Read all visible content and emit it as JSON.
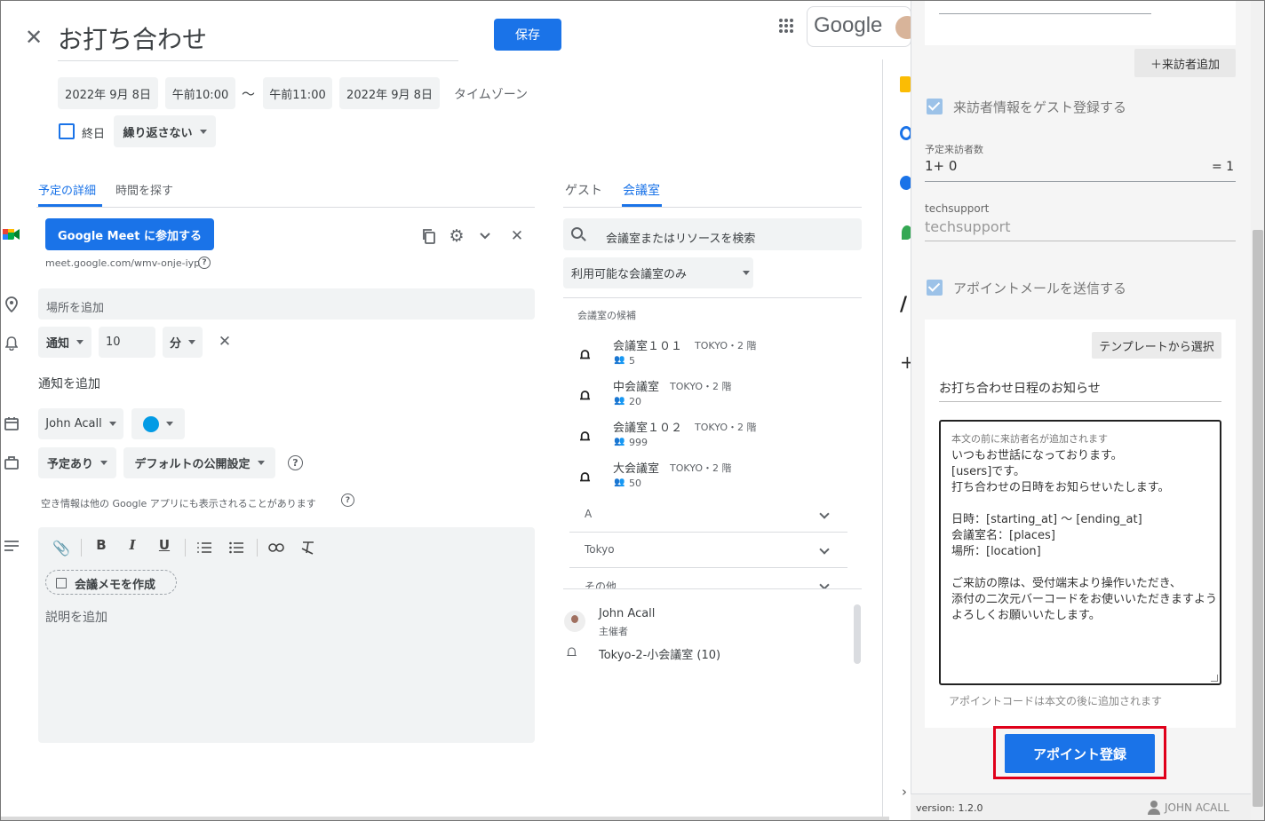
{
  "header": {
    "title": "お打ち合わせ",
    "save_label": "保存",
    "google_label": "Google"
  },
  "datetime": {
    "start_date": "2022年 9月 8日",
    "start_time": "午前10:00",
    "separator": "～",
    "end_time": "午前11:00",
    "end_date": "2022年 9月 8日",
    "timezone": "タイムゾーン"
  },
  "repeat": {
    "allday_label": "終日",
    "repeat_value": "繰り返さない"
  },
  "tabs": {
    "details": "予定の詳細",
    "find_time": "時間を探す",
    "guests": "ゲスト",
    "rooms": "会議室"
  },
  "meet": {
    "button_label": "Google Meet に参加する",
    "link": "meet.google.com/wmv-onje-iyp"
  },
  "location": {
    "placeholder": "場所を追加"
  },
  "notification": {
    "type": "通知",
    "value": "10",
    "unit": "分",
    "add_label": "通知を追加"
  },
  "calendar": {
    "owner": "John Acall",
    "color": "#039be5"
  },
  "availability": {
    "status": "予定あり",
    "visibility": "デフォルトの公開設定",
    "note": "空き情報は他の Google アプリにも表示されることがあります"
  },
  "description": {
    "notes_button": "会議メモを作成",
    "placeholder": "説明を追加"
  },
  "rooms_panel": {
    "search_placeholder": "会議室またはリソースを検索",
    "filter": "利用可能な会議室のみ",
    "candidates_label": "会議室の候補",
    "rooms": [
      {
        "name": "会議室１０１",
        "location": "TOKYO・2 階",
        "capacity": "5"
      },
      {
        "name": "中会議室",
        "location": "TOKYO・2 階",
        "capacity": "20"
      },
      {
        "name": "会議室１０２",
        "location": "TOKYO・2 階",
        "capacity": "999"
      },
      {
        "name": "大会議室",
        "location": "TOKYO・2 階",
        "capacity": "50"
      }
    ],
    "groups": [
      "A",
      "Tokyo",
      "その他"
    ],
    "attendees": [
      {
        "name": "John Acall",
        "role": "主催者"
      },
      {
        "name": "Tokyo-2-小会議室 (10)"
      }
    ]
  },
  "addon": {
    "add_visitor_label": "＋来訪者追加",
    "register_guest_label": "来訪者情報をゲスト登録する",
    "expected_visitors_label": "予定来訪者数",
    "expected_visitors_value": "1+ 0",
    "expected_visitors_total": "= 1",
    "techsupport_label": "techsupport",
    "techsupport_value": "techsupport",
    "send_mail_label": "アポイントメールを送信する",
    "template_button": "テンプレートから選択",
    "subject": "お打ち合わせ日程のお知らせ",
    "body_hint": "本文の前に来訪者名が追加されます",
    "body": "いつもお世話になっております。\n[users]です。\n打ち合わせの日時をお知らせいたします。\n\n日時：[starting_at] ～ [ending_at]\n会議室名：[places]\n場所：[location]\n\nご来訪の際は、受付端末より操作いただき、\n添付の二次元バーコードをお使いいただきますよう\nよろしくお願いいたします。",
    "footer_note": "アポイントコードは本文の後に追加されます",
    "register_button": "アポイント登録",
    "version": "version: 1.2.0",
    "user": "JOHN ACALL"
  },
  "colors": {
    "primary": "#1a73e8",
    "highlight": "#e0001a"
  }
}
